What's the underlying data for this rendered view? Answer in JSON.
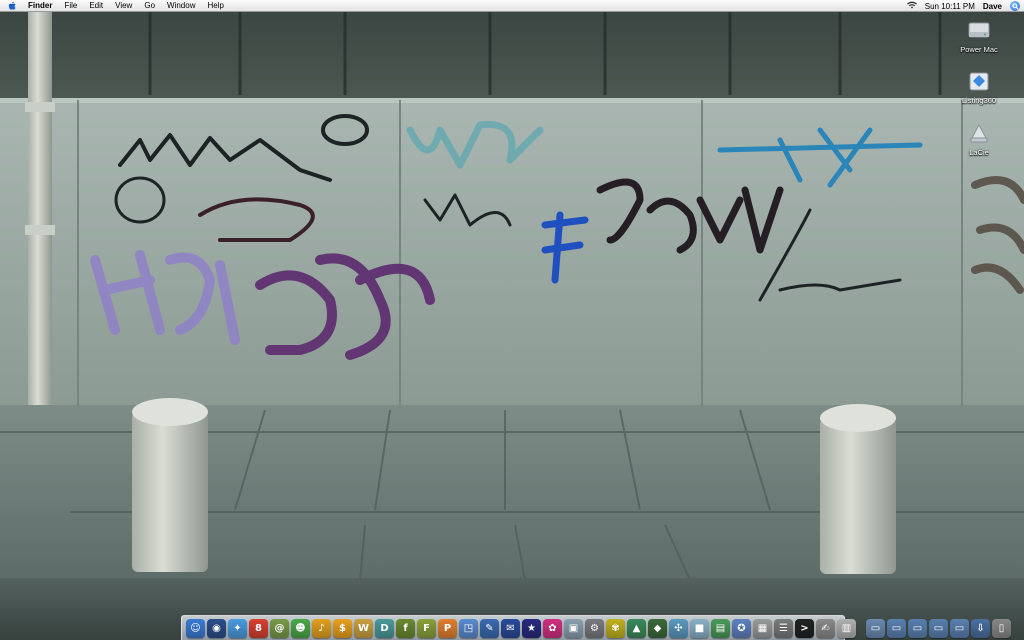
{
  "menubar": {
    "apple_icon": "apple-icon",
    "app_name": "Finder",
    "menus": [
      "File",
      "Edit",
      "View",
      "Go",
      "Window",
      "Help"
    ],
    "clock": "Sun 10:11 PM",
    "user": "Dave",
    "status_icons": [
      "wifi-icon",
      "spotlight-icon"
    ]
  },
  "desktop": {
    "icons": [
      {
        "label": "Power Mac",
        "icon": "hard-drive-icon"
      },
      {
        "label": "Listing360",
        "icon": "disk-image-icon"
      },
      {
        "label": "LaCie",
        "icon": "external-drive-icon"
      }
    ],
    "wallpaper": "graffiti-wall-photo"
  },
  "dock": {
    "apps": [
      {
        "name": "finder-icon",
        "glyph": "☺",
        "color": "#3a7bd5"
      },
      {
        "name": "dashboard-icon",
        "glyph": "◉",
        "color": "#2b4e8c"
      },
      {
        "name": "safari-icon",
        "glyph": "✦",
        "color": "#4a9be0"
      },
      {
        "name": "ical-icon",
        "glyph": "8",
        "color": "#d94030"
      },
      {
        "name": "addressbook-icon",
        "glyph": "@",
        "color": "#7a9a4a"
      },
      {
        "name": "chat-icon",
        "glyph": "☻",
        "color": "#4aa84a"
      },
      {
        "name": "itunes-icon",
        "glyph": "♪",
        "color": "#e0a020"
      },
      {
        "name": "money-icon",
        "glyph": "$",
        "color": "#e8a020"
      },
      {
        "name": "word-icon",
        "glyph": "W",
        "color": "#c8a040"
      },
      {
        "name": "dreamweaver-icon",
        "glyph": "D",
        "color": "#4a9a9a"
      },
      {
        "name": "flash-icon",
        "glyph": "f",
        "color": "#6a8a30"
      },
      {
        "name": "fireworks-icon",
        "glyph": "F",
        "color": "#8aa03a"
      },
      {
        "name": "photoshop-icon",
        "glyph": "P",
        "color": "#e08030"
      },
      {
        "name": "preview-icon",
        "glyph": "◳",
        "color": "#5a8ad0"
      },
      {
        "name": "textedit-icon",
        "glyph": "✎",
        "color": "#3a6ab0"
      },
      {
        "name": "mail-icon",
        "glyph": "✉",
        "color": "#2a4a9a"
      },
      {
        "name": "star-icon",
        "glyph": "★",
        "color": "#2a2a80"
      },
      {
        "name": "flower-icon",
        "glyph": "✿",
        "color": "#d03080"
      },
      {
        "name": "photos-icon",
        "glyph": "▣",
        "color": "#8aa0b0"
      },
      {
        "name": "settings-icon",
        "glyph": "⚙",
        "color": "#7a7a80"
      },
      {
        "name": "flowerpot-icon",
        "glyph": "✾",
        "color": "#c0b020"
      },
      {
        "name": "map-icon",
        "glyph": "▲",
        "color": "#3a8a5a"
      },
      {
        "name": "shield-icon",
        "glyph": "◆",
        "color": "#3a6a3a"
      },
      {
        "name": "network-icon",
        "glyph": "✣",
        "color": "#5a9ac0"
      },
      {
        "name": "cube-icon",
        "glyph": "■",
        "color": "#8ab0c8"
      },
      {
        "name": "box-icon",
        "glyph": "▤",
        "color": "#4a9a5a"
      },
      {
        "name": "tool-icon",
        "glyph": "✪",
        "color": "#6080c0"
      },
      {
        "name": "spreadsheet-icon",
        "glyph": "▦",
        "color": "#9a9a9a"
      },
      {
        "name": "list-icon",
        "glyph": "☰",
        "color": "#7a7a7a"
      },
      {
        "name": "terminal-icon",
        "glyph": ">",
        "color": "#222222"
      },
      {
        "name": "script-icon",
        "glyph": "✍",
        "color": "#8a8a8a"
      },
      {
        "name": "calculator-icon",
        "glyph": "▥",
        "color": "#b0b0b0"
      }
    ],
    "docs": [
      {
        "name": "folder-icon-1",
        "glyph": "▭",
        "color": "#6a8ab0"
      },
      {
        "name": "folder-icon-2",
        "glyph": "▭",
        "color": "#5a80b0"
      },
      {
        "name": "folder-icon-3",
        "glyph": "▭",
        "color": "#5a80b0"
      },
      {
        "name": "folder-icon-4",
        "glyph": "▭",
        "color": "#5a80b0"
      },
      {
        "name": "folder-icon-5",
        "glyph": "▭",
        "color": "#5a80b0"
      },
      {
        "name": "download-icon",
        "glyph": "⇩",
        "color": "#4a70a0"
      },
      {
        "name": "trash-icon",
        "glyph": "▯",
        "color": "#888888"
      }
    ]
  }
}
